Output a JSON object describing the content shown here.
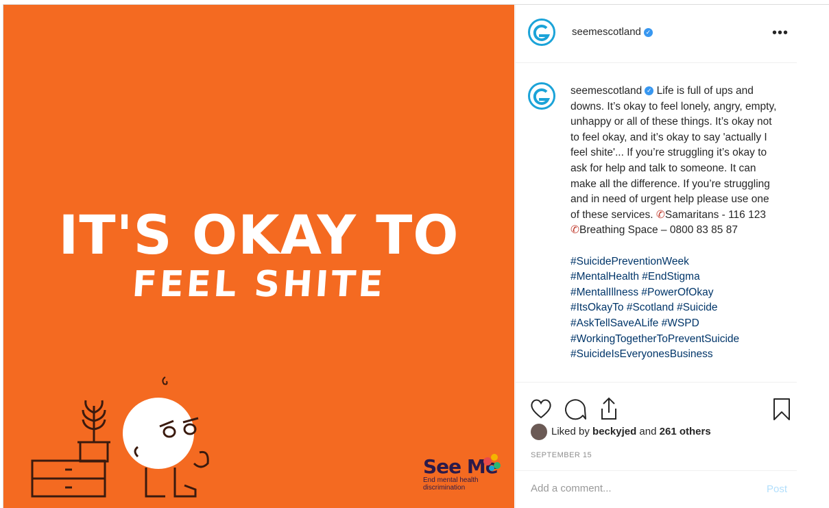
{
  "image": {
    "line1": "IT'S OKAY TO",
    "line2": "FEEL SHITE",
    "logo_name": "See Me",
    "logo_tag1": "End mental health",
    "logo_tag2": "discrimination",
    "bg_color": "#f46a21"
  },
  "header": {
    "username": "seemescotland",
    "more_label": "•••"
  },
  "caption": {
    "username": "seemescotland",
    "text": "Life is full of ups and downs. It’s okay to feel lonely, angry, empty, unhappy or all of these things. It’s okay not to feel okay, and it’s okay to say 'actually I feel shite'... If you’re struggling it’s okay to ask for help and talk to someone. It can make all the difference. If you’re struggling and in need of urgent help please use one of these services. ",
    "service1": "Samaritans - 116 123",
    "service2": "Breathing Space – 0800 83 85 87",
    "hashtags": [
      "#SuicidePreventionWeek",
      "#MentalHealth #EndStigma",
      "#MentalIllness #PowerOfOkay",
      "#ItsOkayTo #Scotland #Suicide",
      "#AskTellSaveALife #WSPD",
      "#WorkingTogetherToPreventSuicide",
      "#SuicideIsEveryonesBusiness"
    ]
  },
  "actions": {
    "liked_by_prefix": "Liked by ",
    "liked_by_user": "beckyjed",
    "liked_by_suffix": " and ",
    "others": "261 others",
    "date": "SEPTEMBER 15"
  },
  "comment_box": {
    "placeholder": "Add a comment...",
    "post_label": "Post"
  },
  "icons": [
    "heart-icon",
    "comment-icon",
    "share-icon",
    "bookmark-icon",
    "phone-icon",
    "verified-icon",
    "more-icon"
  ]
}
